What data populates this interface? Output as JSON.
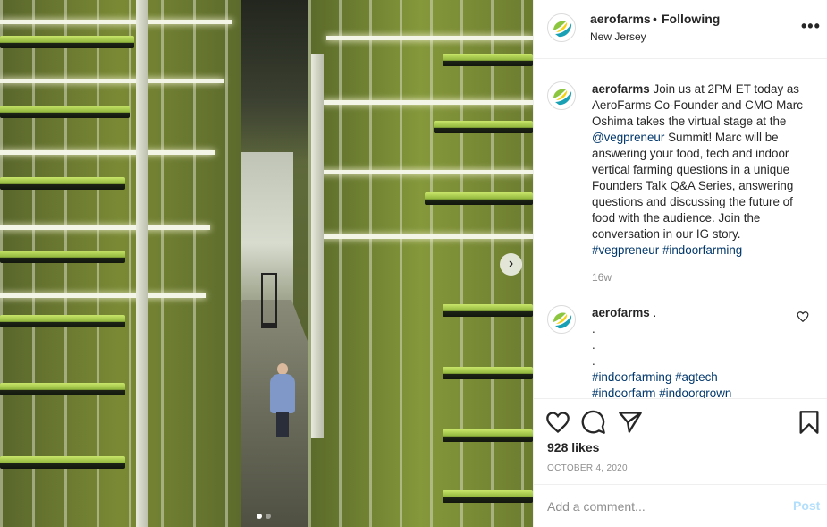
{
  "photo": {
    "carousel_index": 1,
    "carousel_count": 2,
    "next_icon": "chevron-right-icon"
  },
  "header": {
    "username": "aerofarms",
    "separator": "•",
    "follow_status": "Following",
    "location": "New Jersey",
    "more_icon": "more-options-icon",
    "more_label": "•••"
  },
  "caption": {
    "username": "aerofarms",
    "text": "Join us at 2PM ET today as AeroFarms Co-Founder and CMO Marc Oshima takes the virtual stage at the",
    "mention": "@vegpreneur",
    "text2": "Summit! Marc will be answering your food, tech and indoor vertical farming questions in a unique Founders Talk Q&A Series, answering questions and discussing the future of food with the audience. Join the conversation in our IG story.",
    "hashtag1": "#vegpreneur",
    "hashtag2": "#indoorfarming",
    "time": "16w"
  },
  "comment": {
    "username": "aerofarms",
    "dot_lines": [
      ".",
      ".",
      "."
    ],
    "hashtag1": "#indoorfarming",
    "hashtag2": "#agtech",
    "hashtag3": "#indoorfarm",
    "hashtag4": "#indoorgrown"
  },
  "actions": {
    "likes": "928 likes",
    "date": "OCTOBER 4, 2020",
    "comment_placeholder": "Add a comment...",
    "post_label": "Post"
  },
  "colors": {
    "link": "#00376b",
    "muted": "#8e8e8e",
    "post_disabled": "#b2dffc",
    "logo_green": "#8cc63f",
    "logo_yellow": "#f5d312",
    "logo_teal": "#1aa0b5"
  }
}
